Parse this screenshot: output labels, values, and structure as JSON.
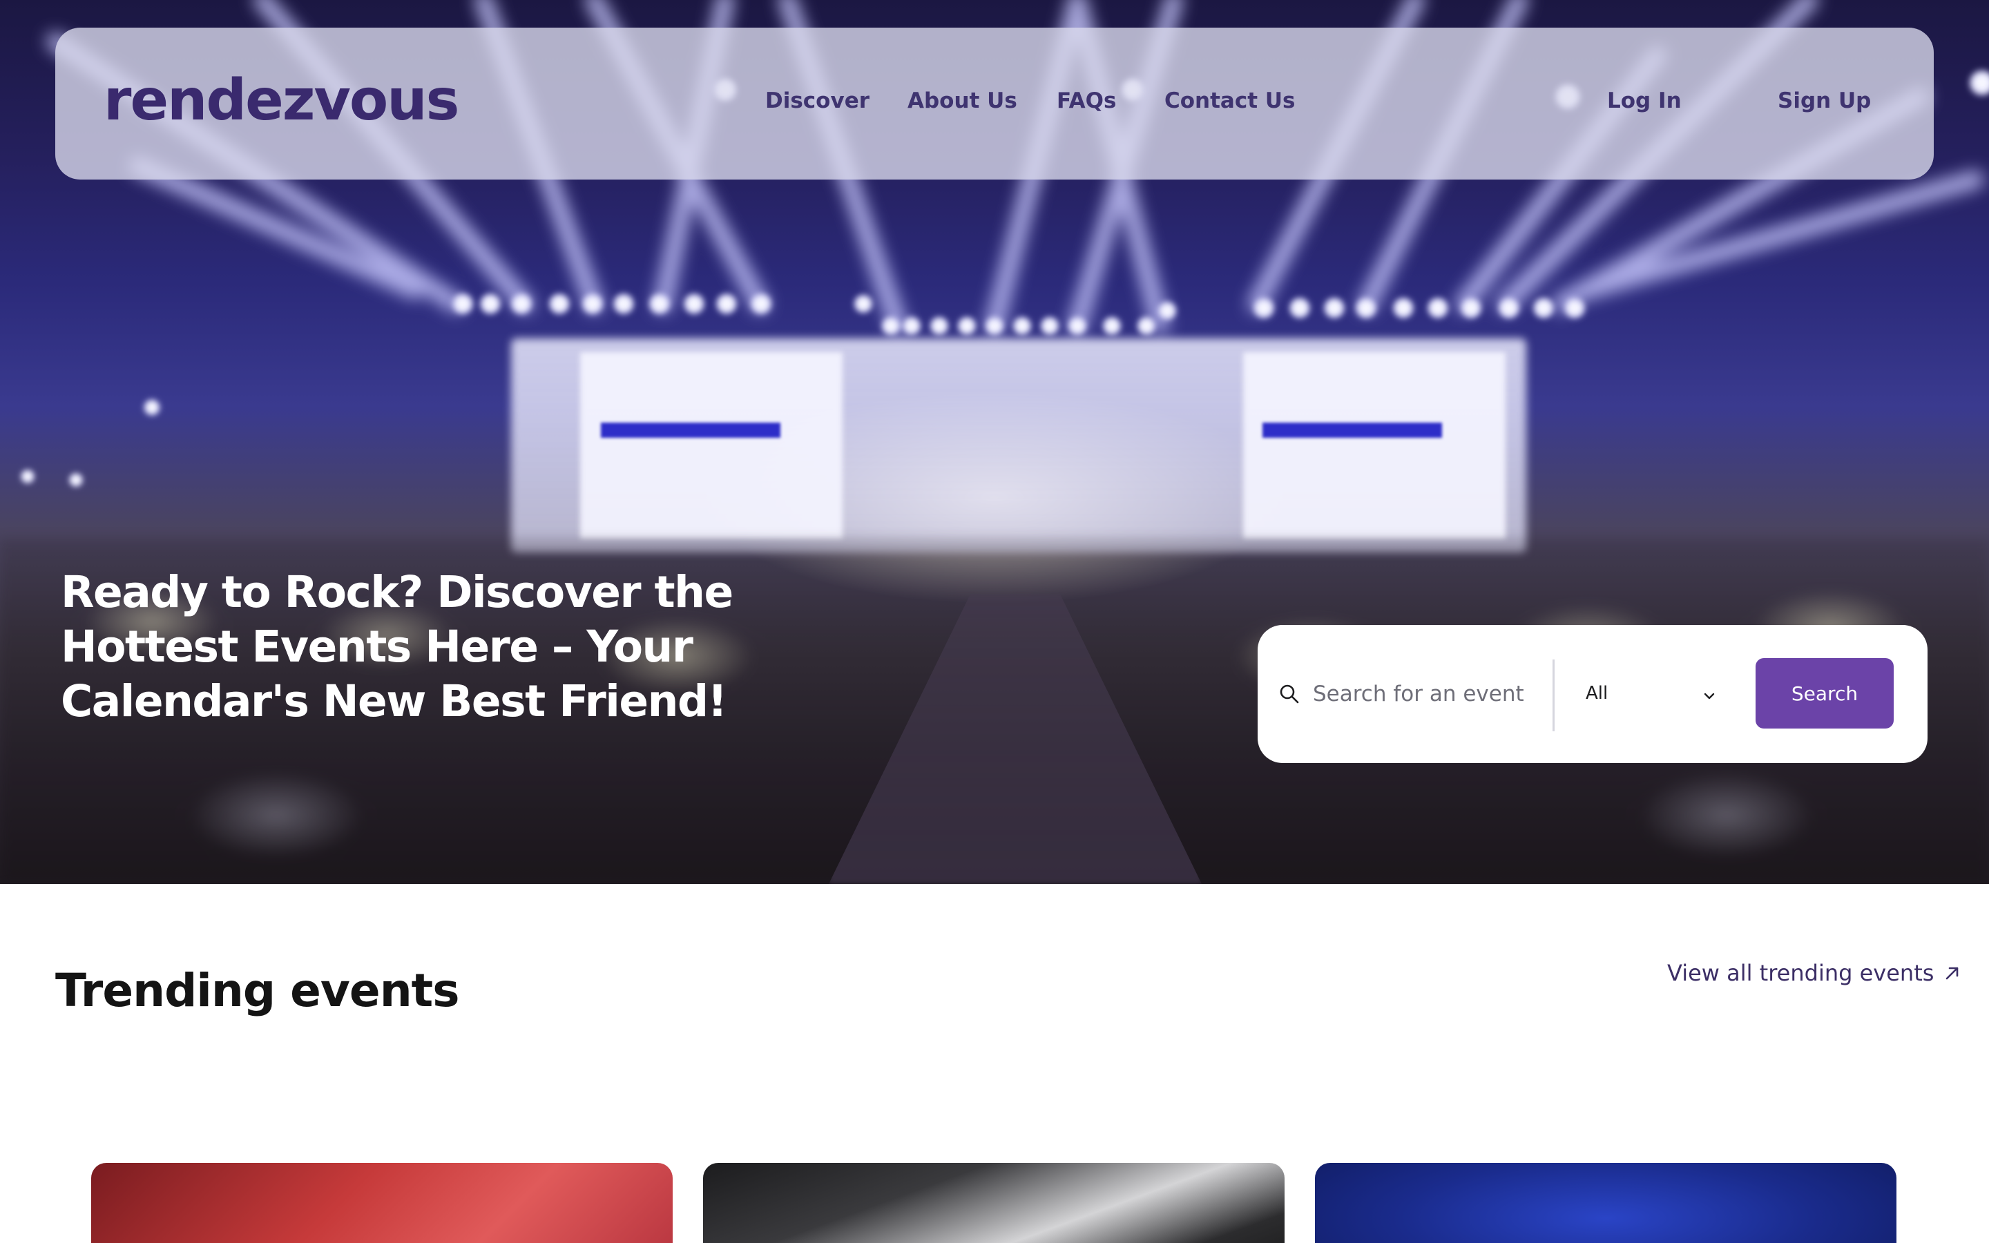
{
  "brand": {
    "name": "rendezvous"
  },
  "nav": {
    "links": [
      {
        "label": "Discover"
      },
      {
        "label": "About Us"
      },
      {
        "label": "FAQs"
      },
      {
        "label": "Contact Us"
      }
    ],
    "login_label": "Log In",
    "signup_label": "Sign Up"
  },
  "hero": {
    "headline_lines": [
      "Ready to Rock? Discover the",
      "Hottest Events Here – Your",
      "Calendar's New Best Friend!"
    ]
  },
  "search": {
    "placeholder": "Search for an event",
    "value": "",
    "category_selected": "All",
    "button_label": "Search"
  },
  "trending": {
    "title": "Trending events",
    "view_all_label": "View all trending events"
  },
  "icons": {
    "search": "search-icon",
    "dropdown": "chevron-down-icon",
    "view_all": "arrow-up-right-icon"
  },
  "colors": {
    "accent": "#6b43a8",
    "brand_text": "#3a2a6e",
    "nav_bg": "rgba(220,220,238,0.78)"
  }
}
